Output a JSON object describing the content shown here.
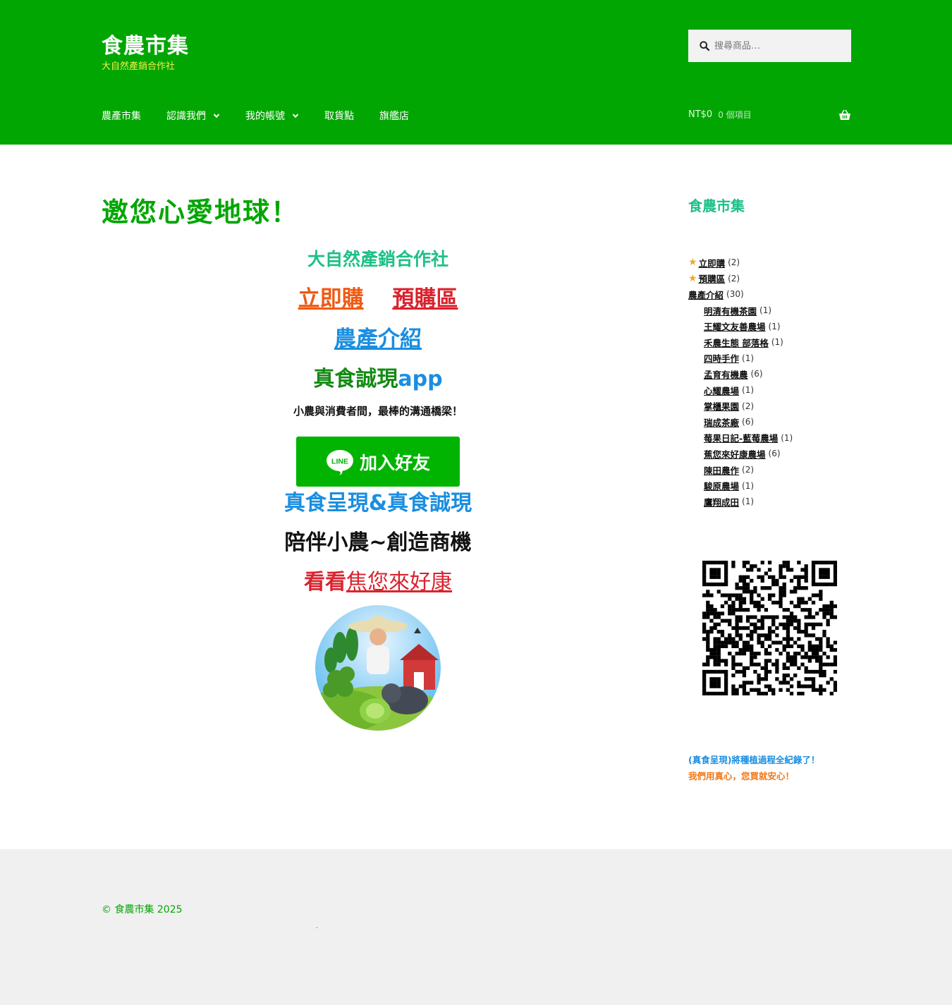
{
  "header": {
    "site_title": "食農市集",
    "tagline": "大自然產銷合作社",
    "search_placeholder": "搜尋商品…",
    "nav": [
      "農產市集",
      "認識我們",
      "我的帳號",
      "取貨點",
      "旗艦店"
    ],
    "cart_price": "NT$0",
    "cart_count": "0 個項目"
  },
  "main": {
    "page_title": "邀您心愛地球！",
    "coop_name": "大自然產銷合作社",
    "buy_now": "立即購",
    "preorder": "預購區",
    "farm_intro": "農產介紹",
    "app_name_green": "真食誠現",
    "app_name_blue": "app",
    "bridge_text": "小農與消費者間，最棒的溝通橋梁！",
    "line_button": "加入好友",
    "line_logo_text": "LINE",
    "present_text": "真食呈現&真食誠現",
    "companion_text": "陪伴小農~創造商機",
    "look_prefix": "看看",
    "look_link": "焦您來好康"
  },
  "sidebar": {
    "title": "食農市集",
    "categories": [
      {
        "name": "立即購",
        "count": "(2)",
        "starred": true,
        "child": false
      },
      {
        "name": "預購區",
        "count": "(2)",
        "starred": true,
        "child": false
      },
      {
        "name": "農產介紹",
        "count": "(30)",
        "starred": false,
        "child": false
      },
      {
        "name": "明清有機茶園",
        "count": "(1)",
        "starred": false,
        "child": true
      },
      {
        "name": "王耀文友善農場",
        "count": "(1)",
        "starred": false,
        "child": true
      },
      {
        "name": "禾農生態 部落格",
        "count": "(1)",
        "starred": false,
        "child": true
      },
      {
        "name": "四時手作",
        "count": "(1)",
        "starred": false,
        "child": true
      },
      {
        "name": "孟育有機農",
        "count": "(6)",
        "starred": false,
        "child": true
      },
      {
        "name": "心耀農場",
        "count": "(1)",
        "starred": false,
        "child": true
      },
      {
        "name": "掌櫃果園",
        "count": "(2)",
        "starred": false,
        "child": true
      },
      {
        "name": "瑞成茶廠",
        "count": "(6)",
        "starred": false,
        "child": true
      },
      {
        "name": "莓果日記-藍莓農場",
        "count": "(1)",
        "starred": false,
        "child": true
      },
      {
        "name": "蕉您來好康農場",
        "count": "(6)",
        "starred": false,
        "child": true
      },
      {
        "name": "陳田農作",
        "count": "(2)",
        "starred": false,
        "child": true
      },
      {
        "name": "駿原農場",
        "count": "(1)",
        "starred": false,
        "child": true
      },
      {
        "name": "鷹翔成田",
        "count": "(1)",
        "starred": false,
        "child": true
      }
    ],
    "note1": "(真食呈現)將種植過程全紀錄了！",
    "note2": "我們用真心，您買就安心！"
  },
  "footer": {
    "copyright": "© 食農市集 2025",
    "dot": "."
  },
  "colors": {
    "header_bg": "#02a602",
    "tagline": "#f3f04a",
    "accent_teal": "#1ec086",
    "link_blue": "#1a8ee0",
    "red": "#d9232e",
    "orange": "#f05a14"
  }
}
